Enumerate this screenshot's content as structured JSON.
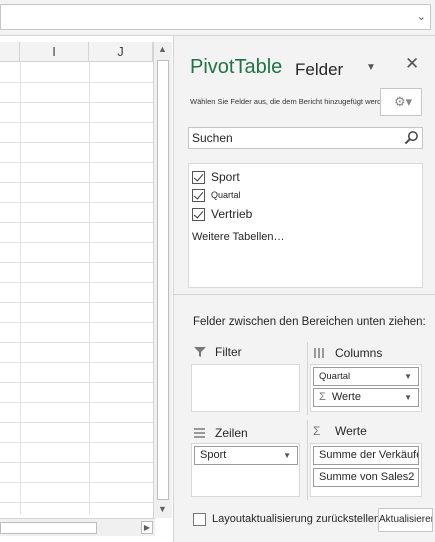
{
  "topbar": {
    "chevron_icon": "chevron-down-icon"
  },
  "grid": {
    "column_headers": [
      "I",
      "J"
    ]
  },
  "pane": {
    "title_part1": "PivotTable",
    "title_part2": "Felder",
    "subtitle": "Wählen Sie Felder aus, die dem Bericht hinzugefügt werden sollen:",
    "close_glyph": "✕",
    "dropdown_glyph": "▼",
    "search_value": "Suchen",
    "fields": [
      {
        "label": "Sport",
        "checked": true
      },
      {
        "label": "Quartal",
        "checked": true
      },
      {
        "label": "Vertrieb",
        "checked": true
      }
    ],
    "more_tables": "Weitere Tabellen…",
    "drag_hint": "Felder zwischen den Bereichen unten ziehen:",
    "areas": {
      "filter": {
        "label": "Filter"
      },
      "columns": {
        "label": "Columns",
        "items": [
          "Quartal",
          "Werte"
        ]
      },
      "rows": {
        "label": "Zeilen",
        "items": [
          "Sport"
        ]
      },
      "values": {
        "label": "Werte",
        "items": [
          "Summe der Verkäufe",
          "Summe von Sales2"
        ]
      }
    },
    "defer_update_label": "Layoutaktualisierung zurückstellen",
    "update_button": "Aktualisieren",
    "colors": {
      "accent": "#217346",
      "pane_bg": "#f3f3f3"
    }
  }
}
